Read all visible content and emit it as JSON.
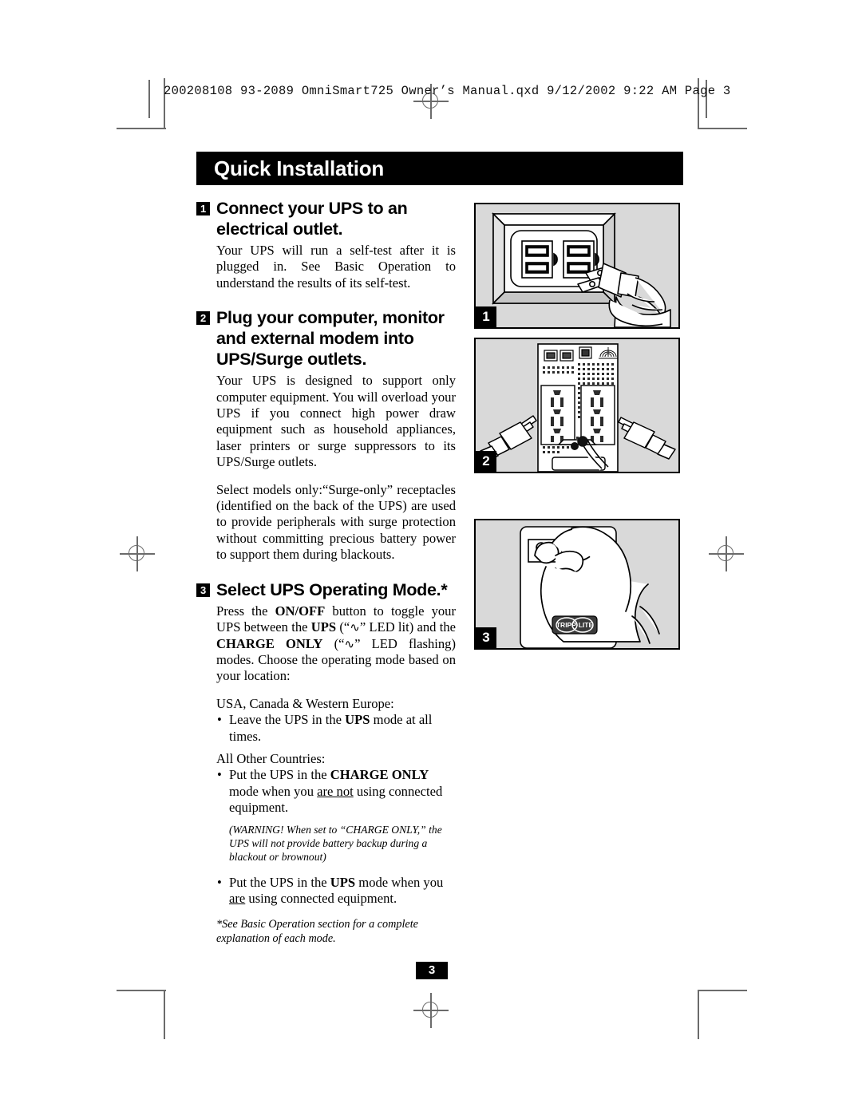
{
  "prepress": {
    "filestamp": "200208108 93-2089 OmniSmart725 Owner’s Manual.qxd  9/12/2002  9:22 AM  Page 3"
  },
  "header": {
    "title": "Quick Installation"
  },
  "steps": [
    {
      "number": "1",
      "title": "Connect your UPS to an electrical outlet.",
      "body": "Your UPS will run a self-test after it is plugged in. See Basic Operation to understand the results of its self-test."
    },
    {
      "number": "2",
      "title": "Plug your computer, monitor and external modem into UPS/Surge outlets.",
      "body": "Your UPS is designed to support only computer equipment. You will overload your UPS if you connect high power draw equipment such as household appliances, laser printers or surge suppressors to its UPS/Surge outlets.",
      "body2": "Select models only:“Surge-only” receptacles (identified on the back of the UPS) are used to provide peripherals with surge protection without committing precious battery power to support them during blackouts."
    },
    {
      "number": "3",
      "title": "Select UPS Operating Mode.*",
      "body_parts": {
        "p1": "Press the ",
        "onoff": "ON/OFF",
        "p2": " button to toggle your UPS between the ",
        "ups": "UPS",
        "p3": " (“",
        "led1": "∿",
        "p4": "” LED lit) and the ",
        "charge_only": "CHARGE ONLY",
        "p5": " (“",
        "led2": "∿",
        "p6": "” LED flashing) modes. Choose the operating mode based on your location:"
      },
      "region1_label": "USA, Canada & Western Europe:",
      "region1_bullet": {
        "pre": "Leave the UPS in the ",
        "bold": "UPS",
        "post": " mode at all times."
      },
      "region2_label": "All Other Countries:",
      "region2_bullet": {
        "pre": "Put the UPS in the ",
        "bold": "CHARGE ONLY",
        "mid": " mode when you ",
        "underline": "are not",
        "post": " using connected equipment."
      },
      "warning": "(WARNING! When set to “CHARGE ONLY,” the UPS will not provide battery backup during a blackout or brownout)",
      "region3_bullet": {
        "pre": "Put the UPS in the ",
        "bold": "UPS",
        "mid": " mode when you ",
        "underline": "are",
        "post": " using connected equipment."
      },
      "footnote": "*See Basic Operation section for a complete explanation of each mode."
    }
  ],
  "figures": [
    {
      "badge": "1",
      "name": "wall-outlet-plug-illustration",
      "caption_alt": "Hand plugging UPS power cord into a duplex wall outlet"
    },
    {
      "badge": "2",
      "name": "ups-rear-outlets-illustration",
      "caption_alt": "Rear panel of UPS showing UPS/Surge outlets with two plugs being connected"
    },
    {
      "badge": "3",
      "name": "ups-power-button-illustration",
      "caption_alt": "Hand pressing the ON/OFF button on the front of the UPS with Tripp Lite logo"
    }
  ],
  "footer": {
    "page_number": "3"
  },
  "colors": {
    "banner_bg": "#000000",
    "banner_text": "#ffffff",
    "figure_bg": "#d9d9d9",
    "mark": "#6b6b6b"
  },
  "logo": {
    "brand": "TRIPP·LITE"
  }
}
